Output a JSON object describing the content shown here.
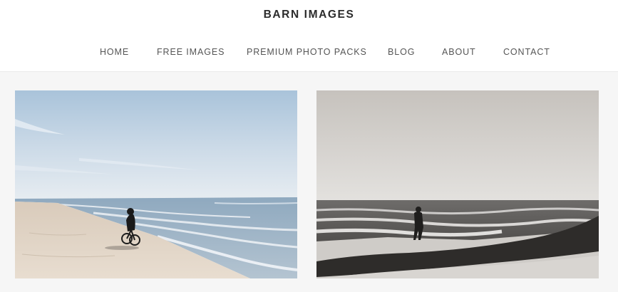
{
  "header": {
    "site_title": "BARN IMAGES"
  },
  "nav": {
    "items": [
      {
        "label": "HOME"
      },
      {
        "label": "FREE IMAGES"
      },
      {
        "label": "PREMIUM PHOTO PACKS"
      },
      {
        "label": "BLOG"
      },
      {
        "label": "ABOUT"
      },
      {
        "label": "CONTACT"
      }
    ]
  },
  "colors": {
    "page_background": "#f6f6f6",
    "header_background": "#ffffff",
    "title_text": "#2b2b2b",
    "nav_text": "#555555"
  },
  "gallery": {
    "photos": [
      {
        "subject": "cyclist riding along a sandy beach beside the sea, blue sky"
      },
      {
        "subject": "black-and-white photo of a person standing on a seaweed-covered shore"
      }
    ]
  }
}
